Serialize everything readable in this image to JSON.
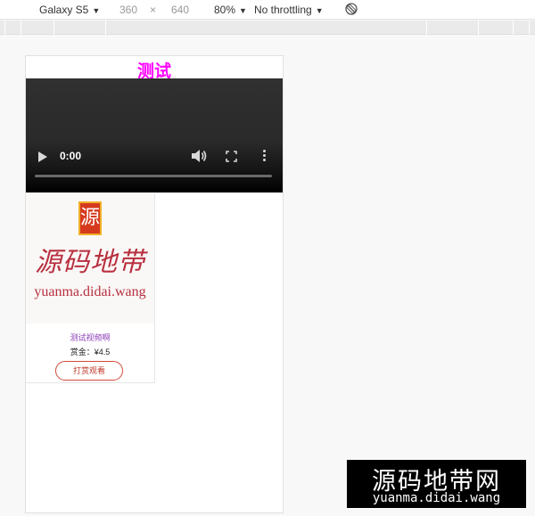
{
  "toolbar": {
    "device": "Galaxy S5",
    "width": "360",
    "times": "×",
    "height": "640",
    "zoom": "80%",
    "throttling": "No throttling",
    "arrow": "▼"
  },
  "page": {
    "title": "测试"
  },
  "video": {
    "time": "0:00"
  },
  "card": {
    "seal_char": "源",
    "logo_cn": "源码地带",
    "logo_en": "yuanma.didai.wang",
    "title": "测试视频啊",
    "price": "赏金：¥4.5",
    "button_label": "打赏观看"
  },
  "watermark": {
    "cn": "源码地带网",
    "en": "yuanma.didai.wang"
  },
  "colors": {
    "title": "#ff00ff",
    "card_title": "#8c3cb8",
    "button_border": "#d24a3a",
    "logo": "#b83040"
  }
}
